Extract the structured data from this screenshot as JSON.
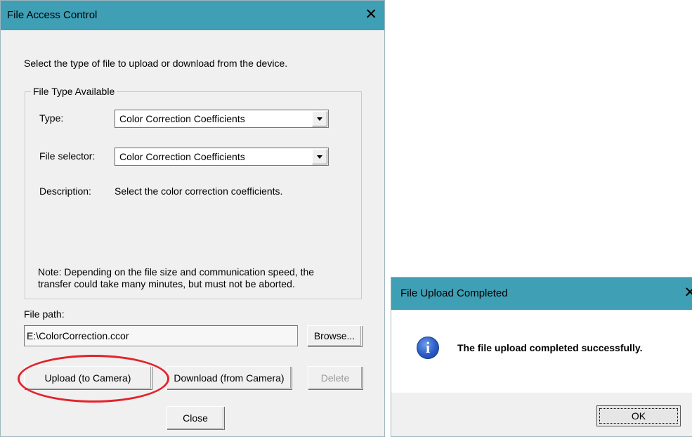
{
  "file_access": {
    "title": "File Access Control",
    "intro": "Select the type of file to upload or download from the device.",
    "group_label": "File Type Available",
    "type_label": "Type:",
    "type_value": "Color Correction Coefficients",
    "selector_label": "File selector:",
    "selector_value": "Color Correction Coefficients",
    "description_label": "Description:",
    "description_value": "Select the color correction coefficients.",
    "note_line1": "Note: Depending on the file size and communication speed, the",
    "note_line2": "transfer could take many minutes, but must not be aborted.",
    "path_label": "File path:",
    "path_value": "E:\\ColorCorrection.ccor",
    "browse_label": "Browse...",
    "upload_label": "Upload (to Camera)",
    "download_label": "Download (from Camera)",
    "delete_label": "Delete",
    "close_label": "Close"
  },
  "upload_completed": {
    "title": "File Upload Completed",
    "message": "The file upload completed successfully.",
    "ok_label": "OK"
  },
  "colors": {
    "titlebar": "#3f9fb5",
    "highlight_circle": "#e3232b"
  },
  "icons": [
    "close-icon",
    "dropdown-arrow-icon",
    "info-icon"
  ]
}
